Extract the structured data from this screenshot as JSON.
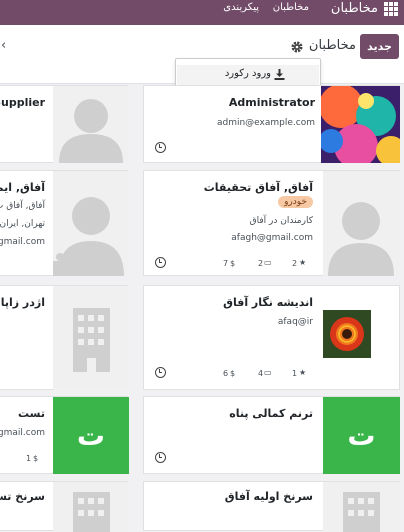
{
  "topnav": {
    "app_name": "مخاطبان",
    "menu": [
      "مخاطبان",
      "پیکربندی"
    ]
  },
  "control": {
    "new_button": "جدید",
    "breadcrumb": "مخاطبان"
  },
  "dropdown": {
    "item": "ورود رکورد"
  },
  "cards": {
    "admin": {
      "name": "Administrator",
      "email": "admin@example.com"
    },
    "supplier": {
      "name": "Supplier"
    },
    "afagh": {
      "name": "آفاق, آفاق تحقیقات",
      "tag": "خودرو",
      "job": "کارمندان در آفاق",
      "email": "afagh@gmail.com",
      "count_stars": "2",
      "count_cards": "2",
      "count_money": "7"
    },
    "left2": {
      "name": "آفاق, ایما",
      "line1": "آفاق, آفاق ت",
      "line2": "تهران, ایران",
      "line3": "gmail.com"
    },
    "andishe": {
      "name": "اندیشه نگار آفاق",
      "email": "afaq@ir",
      "count_stars": "1",
      "count_cards": "4",
      "count_money": "6"
    },
    "left3": {
      "name": "اژدر زاپاتا"
    },
    "tarannom": {
      "name": "ترنم کمالی پناه",
      "initial": "ت"
    },
    "test": {
      "name": "تست",
      "email": "gmail.com",
      "count_money": "1",
      "initial": "ت"
    },
    "sarnakh": {
      "name": "سرنخ اولیه آفاق"
    },
    "left5": {
      "name": "سرنخ تست"
    }
  },
  "icons": {
    "apps": "apps-grid-icon",
    "gear": "gear-icon",
    "download": "download-icon",
    "clock": "clock-icon",
    "star": "star-icon",
    "card": "credit-card-icon",
    "money": "dollar-icon"
  },
  "colors": {
    "brand": "#714b67",
    "letter_avatar": "#39b54a",
    "tag_bg": "#f6c9a4"
  }
}
